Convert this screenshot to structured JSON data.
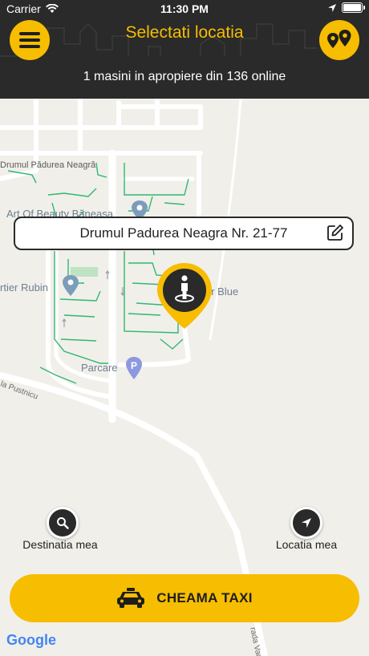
{
  "status_bar": {
    "carrier": "Carrier",
    "time": "11:30 PM"
  },
  "header": {
    "title": "Selectati locatia",
    "subtitle": "1 masini in apropiere din 136 online"
  },
  "map": {
    "labels": {
      "street_top": "Drumul Pădurea Neagră",
      "poi_beauty": "Art Of Beauty Băneasa",
      "poi_rubin": "rtier Rubin",
      "poi_blue": "er Blue",
      "poi_parking": "Parcare",
      "street_pustnicu": "la Pustnicu",
      "street_vadu": "rada Vadu"
    },
    "selected_address": "Drumul Padurea Neagra Nr. 21-77",
    "attribution": "Google"
  },
  "controls": {
    "destination_label": "Destinatia mea",
    "location_label": "Locatia mea",
    "call_taxi_label": "CHEAMA TAXI"
  },
  "colors": {
    "accent": "#f7bd00",
    "header_bg": "#2a2a2a",
    "map_bg": "#f1efea",
    "roads_green": "#2eb872"
  }
}
